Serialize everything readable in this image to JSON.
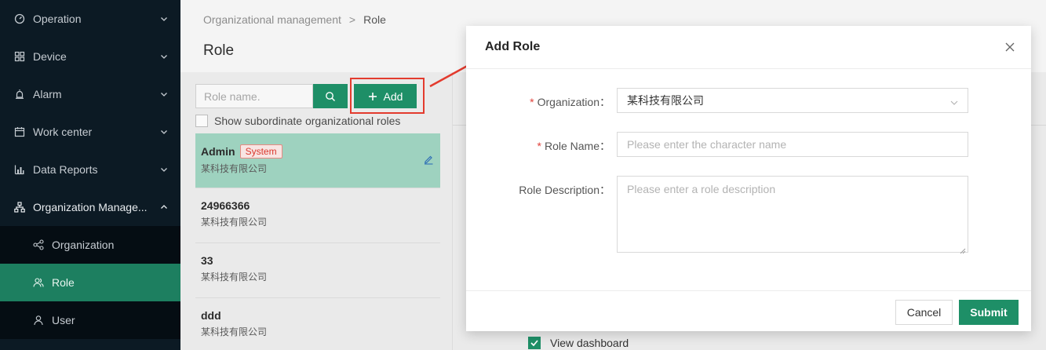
{
  "sidebar": {
    "items": [
      {
        "label": "Operation",
        "icon": "dashboard-icon"
      },
      {
        "label": "Device",
        "icon": "grid-icon"
      },
      {
        "label": "Alarm",
        "icon": "alarm-icon"
      },
      {
        "label": "Work center",
        "icon": "calendar-icon"
      },
      {
        "label": "Data Reports",
        "icon": "bar-chart-icon"
      },
      {
        "label": "Organization Manage...",
        "icon": "org-tree-icon"
      }
    ],
    "sub_items": [
      {
        "label": "Organization",
        "icon": "share-nodes-icon"
      },
      {
        "label": "Role",
        "icon": "users-icon"
      },
      {
        "label": "User",
        "icon": "user-icon"
      }
    ]
  },
  "breadcrumb": {
    "parent": "Organizational management",
    "separator": ">",
    "current": "Role"
  },
  "page_title": "Role",
  "left_panel": {
    "search_placeholder": "Role name.",
    "add_label": "Add",
    "subordinate_label": "Show subordinate organizational roles",
    "roles": [
      {
        "name": "Admin",
        "org": "某科技有限公司",
        "tag": "System"
      },
      {
        "name": "24966366",
        "org": "某科技有限公司"
      },
      {
        "name": "33",
        "org": "某科技有限公司"
      },
      {
        "name": "ddd",
        "org": "某科技有限公司"
      }
    ]
  },
  "right_panel": {
    "view_dashboard": "View dashboard"
  },
  "modal": {
    "title": "Add Role",
    "org_label": "Organization：",
    "org_value": "某科技有限公司",
    "name_label": "Role Name：",
    "name_placeholder": "Please enter the character name",
    "desc_label": "Role Description：",
    "desc_placeholder": "Please enter a role description",
    "required_mark": "*",
    "cancel_label": "Cancel",
    "submit_label": "Submit"
  },
  "colors": {
    "accent": "#1e8f67",
    "sidebar_bg": "#0c1a24",
    "annotation": "#e33b2e",
    "selected_row": "#9ed2bf"
  }
}
